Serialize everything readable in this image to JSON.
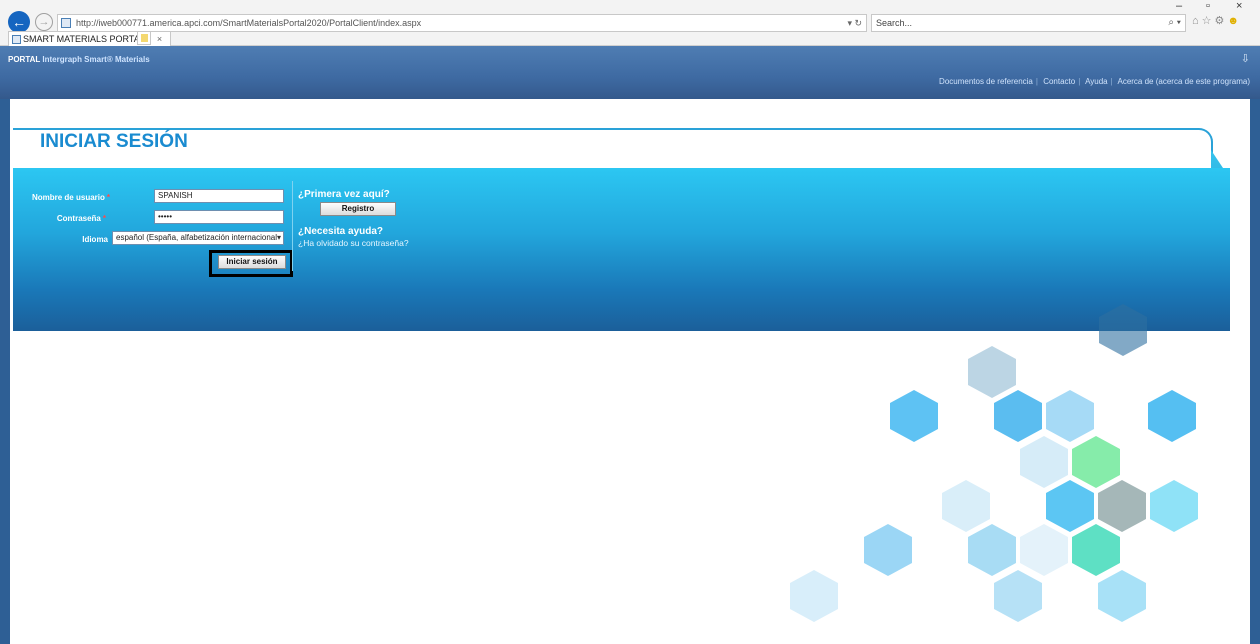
{
  "browser": {
    "url": "http://iweb000771.america.apci.com/SmartMaterialsPortal2020/PortalClient/index.aspx",
    "search_placeholder": "Search...",
    "tab_title": "SMART MATERIALS PORTAL",
    "win_min": "–",
    "win_max": "▫",
    "win_close": "×"
  },
  "header": {
    "portal": "PORTAL",
    "brand": "Intergraph Smart® Materials",
    "links": [
      "Documentos de referencia",
      "Contacto",
      "Ayuda",
      "Acerca de (acerca de este programa)"
    ]
  },
  "login": {
    "title": "INICIAR SESIÓN",
    "username_label": "Nombre de usuario",
    "username_value": "SPANISH",
    "password_label": "Contraseña",
    "password_value": "•••••",
    "language_label": "Idioma",
    "language_value": "español (España, alfabetización internacional)",
    "required_mark": "*",
    "submit_label": "Iniciar sesión"
  },
  "help": {
    "first_time_heading": "¿Primera vez aquí?",
    "register_label": "Registro",
    "need_help_heading": "¿Necesita ayuda?",
    "forgot_link": "¿Ha olvidado su contraseña?"
  },
  "colors": {
    "accent": "#1a8bd0",
    "panel": "#22a6dc",
    "header": "#3e6aa2"
  }
}
